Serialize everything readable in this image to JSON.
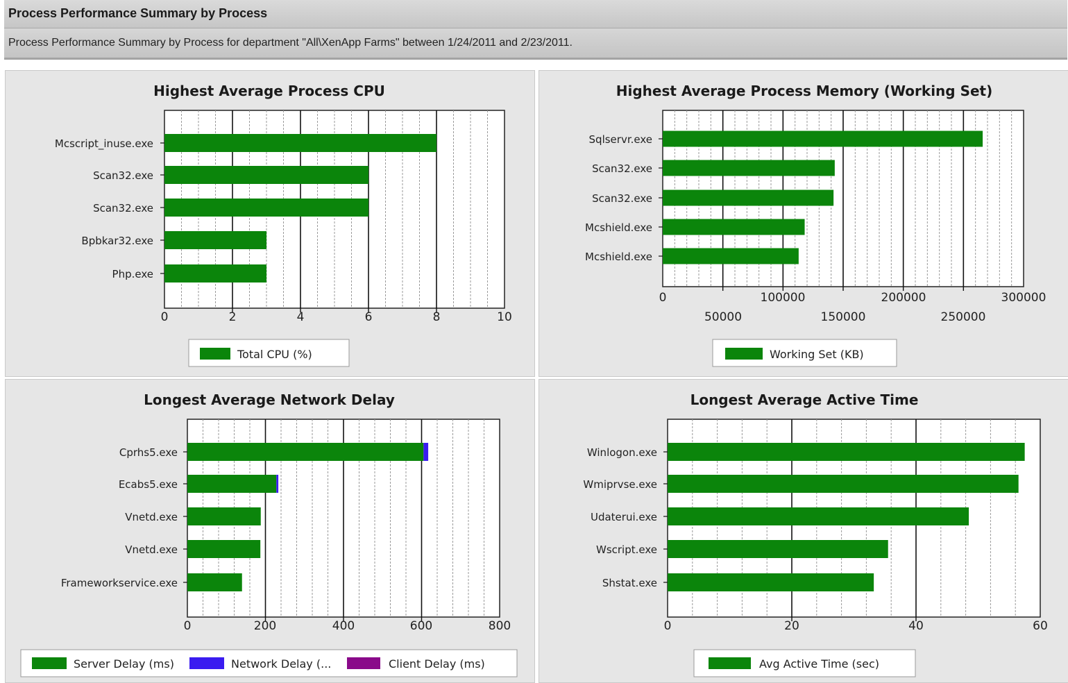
{
  "header": {
    "title": "Process Performance Summary by Process",
    "subtitle": "Process Performance Summary by Process for department \"All\\XenApp Farms\" between 1/24/2011 and 2/23/2011."
  },
  "colors": {
    "server": "#0b850b",
    "network": "#3a1cf0",
    "client": "#8a0a8a"
  },
  "chart_data": [
    {
      "type": "bar",
      "title": "Highest Average Process CPU",
      "categories": [
        "Mcscript_inuse.exe",
        "Scan32.exe",
        "Scan32.exe",
        "Bpbkar32.exe",
        "Php.exe"
      ],
      "series": [
        {
          "name": "Total CPU (%)",
          "values": [
            8.0,
            6.0,
            6.0,
            3.0,
            3.0
          ]
        }
      ],
      "xlim": [
        0,
        10
      ],
      "ticks": [
        "0",
        "2",
        "4",
        "6",
        "8",
        "10"
      ],
      "grid": true,
      "legend": "bottom"
    },
    {
      "type": "bar",
      "title": "Highest Average Process Memory (Working Set)",
      "categories": [
        "Sqlservr.exe",
        "Scan32.exe",
        "Scan32.exe",
        "Mcshield.exe",
        "Mcshield.exe"
      ],
      "series": [
        {
          "name": "Working Set (KB)",
          "values": [
            266000,
            143000,
            142000,
            118000,
            113000
          ]
        }
      ],
      "xlim": [
        0,
        300000
      ],
      "ticks_upper": [
        "0",
        "100000",
        "200000",
        "300000"
      ],
      "ticks_lower": [
        "50000",
        "150000",
        "250000"
      ],
      "grid": true,
      "legend": "bottom"
    },
    {
      "type": "bar",
      "title": "Longest Average Network Delay",
      "categories": [
        "Cprhs5.exe",
        "Ecabs5.exe",
        "Vnetd.exe",
        "Vnetd.exe",
        "Frameworkservice.exe"
      ],
      "series": [
        {
          "name": "Server Delay (ms)",
          "values": [
            605,
            228,
            188,
            187,
            140
          ]
        },
        {
          "name": "Network Delay (...",
          "values": [
            12,
            5,
            0,
            0,
            0
          ]
        },
        {
          "name": "Client Delay (ms)",
          "values": [
            0,
            0,
            0,
            0,
            0
          ]
        }
      ],
      "xlim": [
        0,
        800
      ],
      "ticks": [
        "0",
        "200",
        "400",
        "600",
        "800"
      ],
      "grid": true,
      "legend": "bottom",
      "stacked": true
    },
    {
      "type": "bar",
      "title": "Longest Average Active Time",
      "categories": [
        "Winlogon.exe",
        "Wmiprvse.exe",
        "Udaterui.exe",
        "Wscript.exe",
        "Shstat.exe"
      ],
      "series": [
        {
          "name": "Avg Active Time (sec)",
          "values": [
            57.5,
            56.5,
            48.5,
            35.5,
            33.2
          ]
        }
      ],
      "xlim": [
        0,
        60
      ],
      "ticks": [
        "0",
        "20",
        "40",
        "60"
      ],
      "grid": true,
      "legend": "bottom"
    }
  ]
}
